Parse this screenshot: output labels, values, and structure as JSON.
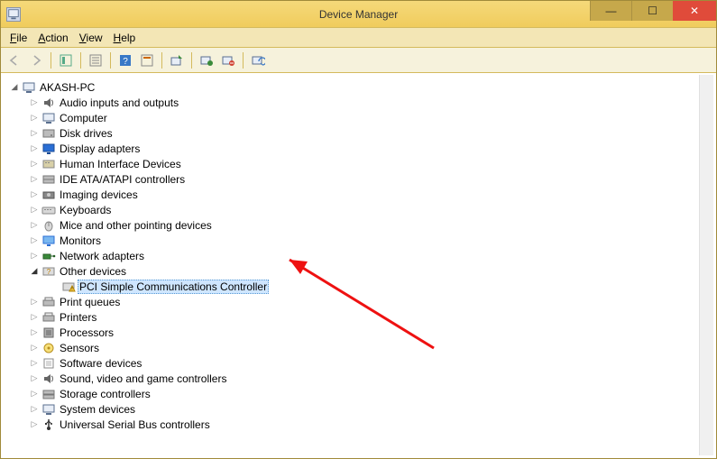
{
  "window": {
    "title": "Device Manager"
  },
  "controls": {
    "min": "—",
    "max": "☐",
    "close": "✕"
  },
  "menu": {
    "file": "File",
    "action": "Action",
    "view": "View",
    "help": "Help"
  },
  "root": "AKASH-PC",
  "categories": [
    "Audio inputs and outputs",
    "Computer",
    "Disk drives",
    "Display adapters",
    "Human Interface Devices",
    "IDE ATA/ATAPI controllers",
    "Imaging devices",
    "Keyboards",
    "Mice and other pointing devices",
    "Monitors",
    "Network adapters",
    "Other devices",
    "Print queues",
    "Printers",
    "Processors",
    "Sensors",
    "Software devices",
    "Sound, video and game controllers",
    "Storage controllers",
    "System devices",
    "Universal Serial Bus controllers"
  ],
  "selected_device": "PCI Simple Communications Controller"
}
